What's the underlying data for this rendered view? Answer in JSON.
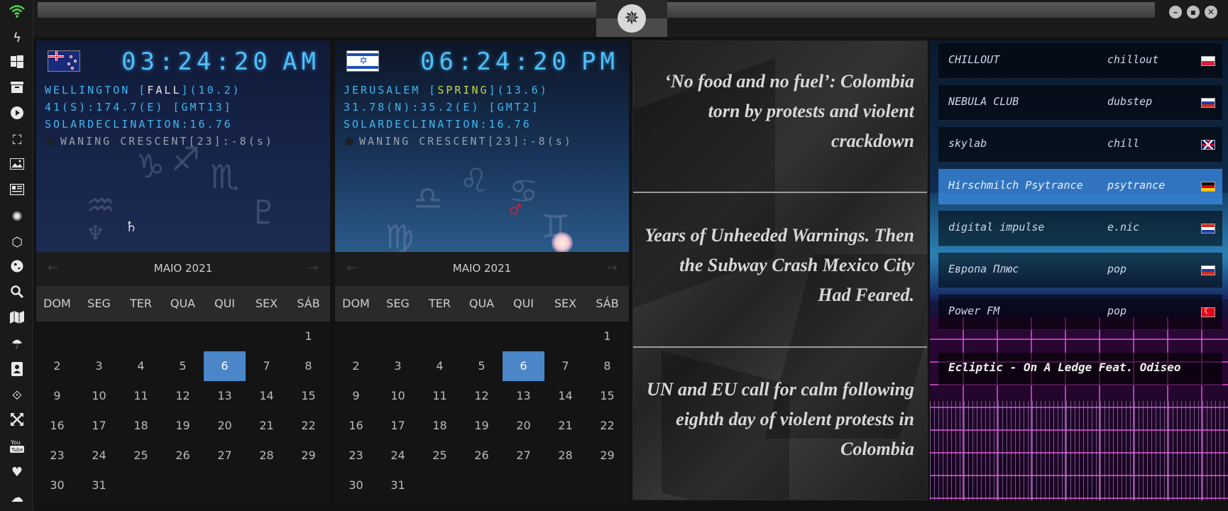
{
  "sidebar": {
    "icons": [
      "wifi-icon",
      "lightning-icon",
      "windows-icon",
      "archive-icon",
      "play-icon",
      "map-pin-icon",
      "image-icon",
      "news-icon",
      "rebel-icon",
      "hexagon-icon",
      "globe-icon",
      "search-icon",
      "map-icon",
      "umbrella-icon",
      "contact-icon",
      "tag-icon",
      "expand-icon",
      "youtube-icon",
      "heart-icon",
      "cloud-icon"
    ]
  },
  "clocks": [
    {
      "time": "03:24:20",
      "ampm": "AM",
      "city_prefix": "WELLINGTON [",
      "season": "FALL",
      "city_suffix": "](10.2)",
      "coords": "41(S):174.7(E) [GMT13]",
      "declination": "SOLARDECLINATION:16.76",
      "moon": "WANING CRESCENT[23]:-8",
      "moon_unit": "(s)"
    },
    {
      "time": "06:24:20",
      "ampm": "PM",
      "city_prefix": "JERUSALEM [",
      "season": "SPRING",
      "city_suffix": "](13.6)",
      "coords": "31.78(N):35.2(E) [GMT2]",
      "declination": "SOLARDECLINATION:16.76",
      "moon": "WANING CRESCENT[23]:-8",
      "moon_unit": "(s)"
    }
  ],
  "calendar": {
    "month_label": "MAIO 2021",
    "prev": "←",
    "next": "→",
    "weekdays": [
      "DOM",
      "SEG",
      "TER",
      "QUA",
      "QUI",
      "SEX",
      "SÁB"
    ],
    "selected_day": 6
  },
  "news": [
    "‘No food and no fuel’: Colombia torn by protests and violent crackdown",
    "Years of Unheeded Warnings. Then the Subway Crash Mexico City Had Feared.",
    "UN and EU call for calm following eighth day of violent protests in Colombia"
  ],
  "radio": {
    "stations": [
      {
        "name": "CHILLOUT",
        "genre": "chillout",
        "flag": "poland"
      },
      {
        "name": "NEBULA CLUB",
        "genre": "dubstep",
        "flag": "russia"
      },
      {
        "name": "skylab",
        "genre": "chill",
        "flag": "uk"
      },
      {
        "name": "Hirschmilch Psytrance",
        "genre": "psytrance",
        "flag": "germany"
      },
      {
        "name": "digital impulse",
        "genre": "e.nic",
        "flag": "croatia"
      },
      {
        "name": "Европа Плюс",
        "genre": "pop",
        "flag": "russia"
      },
      {
        "name": "Power FM",
        "genre": "pop",
        "flag": "turkey"
      }
    ],
    "active_index": 3,
    "now_playing": "Ecliptic - On A Ledge Feat. Odiseo"
  }
}
